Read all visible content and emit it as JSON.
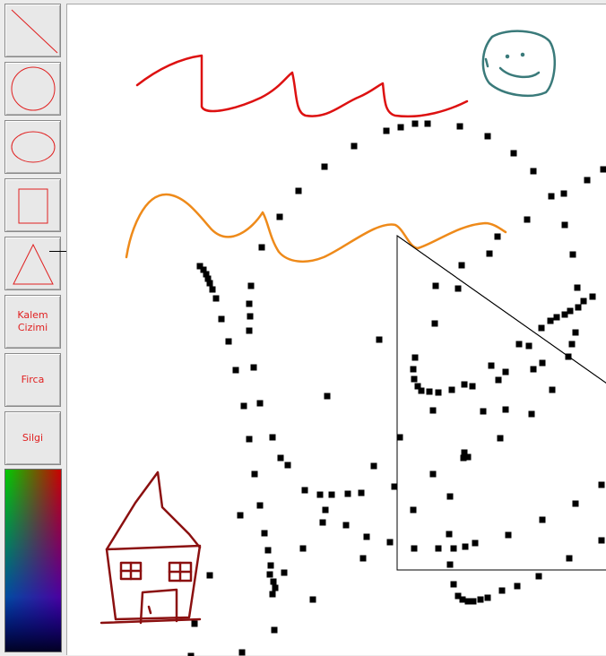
{
  "toolbar": {
    "tools": [
      {
        "id": "line",
        "icon": "line-icon"
      },
      {
        "id": "circle",
        "icon": "circle-icon"
      },
      {
        "id": "ellipse",
        "icon": "ellipse-icon"
      },
      {
        "id": "rectangle",
        "icon": "rectangle-icon"
      },
      {
        "id": "triangle",
        "icon": "triangle-icon",
        "active": true
      },
      {
        "id": "pen",
        "label": "Kalem\nCizimi"
      },
      {
        "id": "brush",
        "label": "Firca"
      },
      {
        "id": "eraser",
        "label": "Silgi"
      }
    ],
    "pen_label_line1": "Kalem",
    "pen_label_line2": "Cizimi",
    "brush_label": "Firca",
    "eraser_label": "Silgi",
    "icon_color": "#e02020"
  },
  "palette": {
    "icon": "color-palette"
  },
  "canvas": {
    "background": "#ffffff",
    "stroke_colors": {
      "red_wave": "#dd1111",
      "orange_wave": "#ee8a1a",
      "smiley": "#3a7a7a",
      "house": "#8b1010",
      "triangle": "#000000",
      "dots": "#000000"
    }
  }
}
